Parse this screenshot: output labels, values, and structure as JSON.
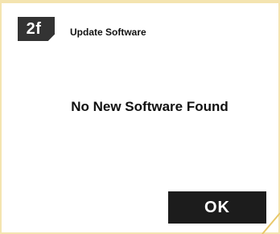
{
  "step": {
    "badge_label": "2f"
  },
  "dialog": {
    "title": "Update Software",
    "message": "No New Software Found",
    "ok_label": "OK"
  },
  "colors": {
    "frame_border": "#f4e4b0",
    "badge_bg": "#333333",
    "button_bg": "#1c1c1c",
    "accent_line": "#e8c86a"
  }
}
